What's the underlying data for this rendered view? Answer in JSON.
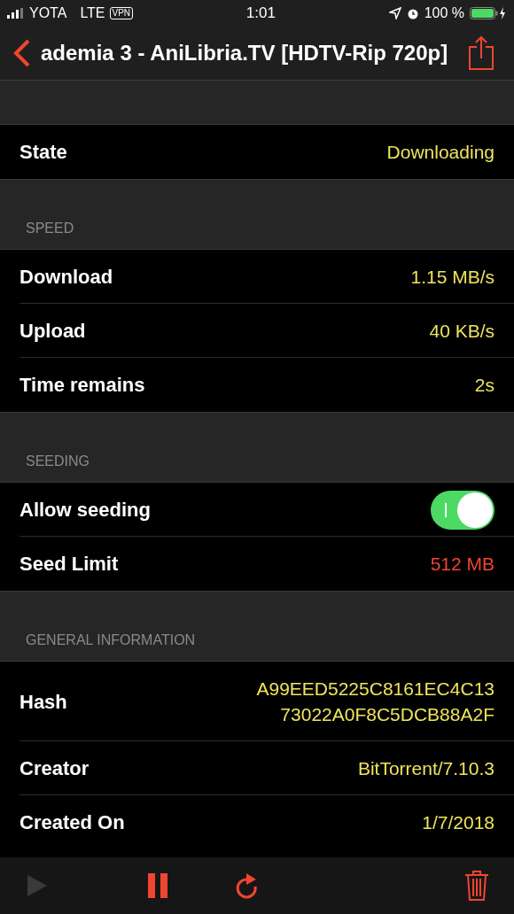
{
  "status_bar": {
    "signal": "YOTA",
    "network": "LTE",
    "vpn": "VPN",
    "time": "1:01",
    "battery": "100 %"
  },
  "nav": {
    "title": "ademia 3 - AniLibria.TV [HDTV-Rip 720p]"
  },
  "sections": [
    {
      "rows": [
        {
          "kind": "value",
          "label": "State",
          "value": "Downloading",
          "color": "#efe35c"
        }
      ]
    },
    {
      "header": "SPEED",
      "rows": [
        {
          "kind": "value",
          "label": "Download",
          "value": "1.15 MB/s",
          "color": "#efe35c"
        },
        {
          "kind": "value",
          "label": "Upload",
          "value": "40 KB/s",
          "color": "#efe35c"
        },
        {
          "kind": "value",
          "label": "Time remains",
          "value": "2s",
          "color": "#efe35c"
        }
      ]
    },
    {
      "header": "SEEDING",
      "rows": [
        {
          "kind": "toggle",
          "label": "Allow seeding",
          "on": true
        },
        {
          "kind": "value",
          "label": "Seed Limit",
          "value": "512 MB",
          "color": "#f2452f"
        }
      ]
    },
    {
      "header": "GENERAL INFORMATION",
      "rows": [
        {
          "kind": "multiline",
          "label": "Hash",
          "lines": [
            "A99EED5225C8161EC4C13",
            "73022A0F8C5DCB88A2F"
          ],
          "color": "#efe35c"
        },
        {
          "kind": "value",
          "label": "Creator",
          "value": "BitTorrent/7.10.3",
          "color": "#efe35c"
        },
        {
          "kind": "value",
          "label": "Created On",
          "value": "1/7/2018",
          "color": "#efe35c"
        }
      ]
    }
  ],
  "toolbar": [
    {
      "kind": "play",
      "disabled": true
    },
    {
      "kind": "pause",
      "disabled": false
    },
    {
      "kind": "refresh",
      "disabled": false
    },
    {
      "kind": "trash",
      "disabled": false
    }
  ]
}
